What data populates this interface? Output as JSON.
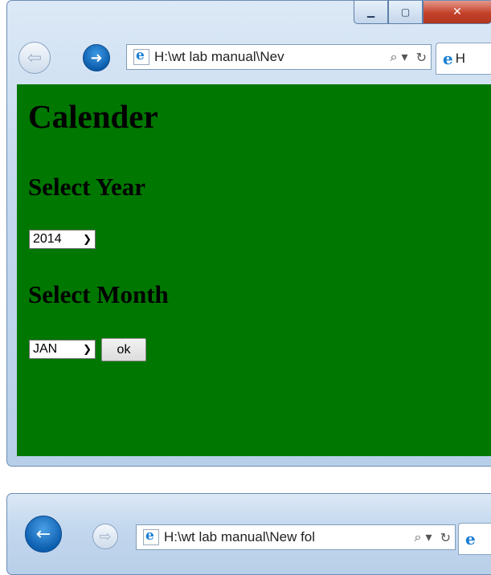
{
  "window1": {
    "address_text": "H:\\wt lab manual\\Nev",
    "search_glyph": "⌕ ▾",
    "refresh_glyph": "↻",
    "tab_label": "H",
    "caption": {
      "minimize": "▁",
      "maximize": "▢",
      "close": "✕"
    },
    "back_glyph": "⇦",
    "forward_glyph": "➜"
  },
  "page": {
    "heading": "Calender",
    "select_year_label": "Select Year",
    "year_value": "2014",
    "select_month_label": "Select Month",
    "month_value": "JAN",
    "ok_label": "ok",
    "background_color": "#007700"
  },
  "window2": {
    "address_text": "H:\\wt lab manual\\New fol",
    "search_glyph": "⌕ ▾",
    "refresh_glyph": "↻",
    "back_glyph": "←",
    "forward_glyph": "⇨"
  },
  "icons": {
    "dropdown": "chevron-down-icon",
    "page": "ie-page-icon"
  }
}
